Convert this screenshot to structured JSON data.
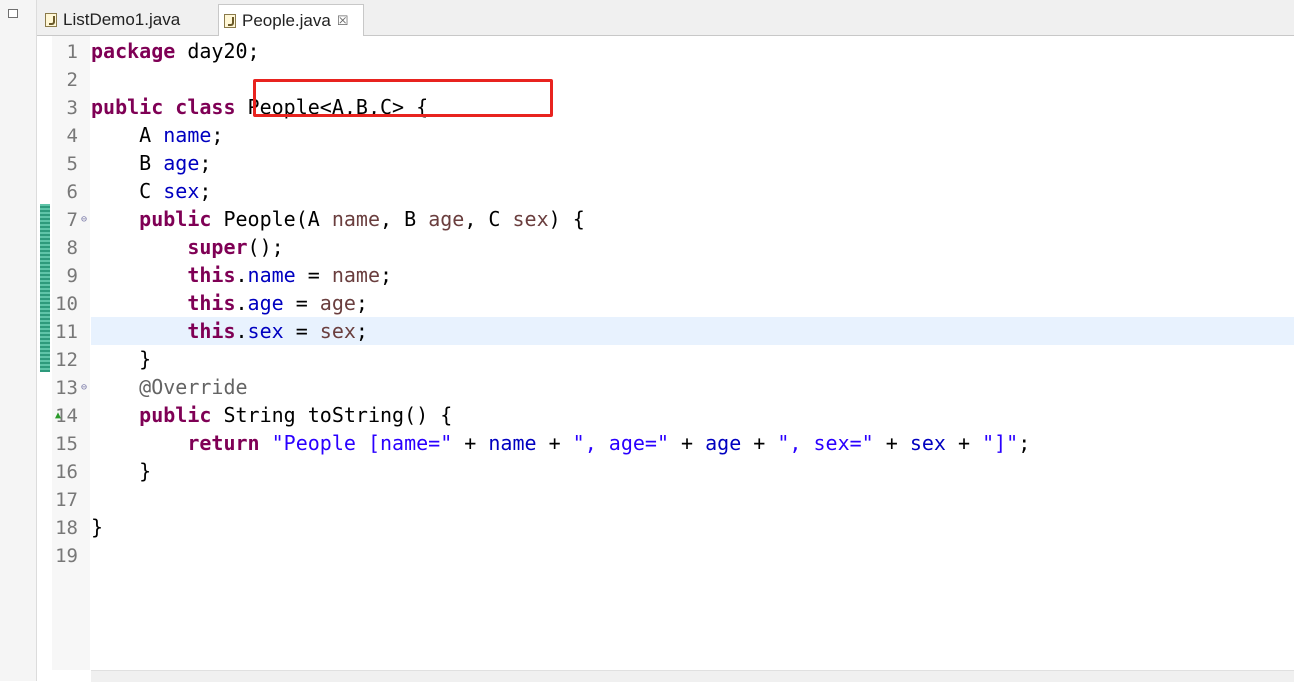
{
  "tabs": [
    {
      "label": "ListDemo1.java",
      "active": false
    },
    {
      "label": "People.java",
      "active": true,
      "close": "☒"
    }
  ],
  "colors": {
    "keyword": "#7f0055",
    "field": "#0000c0",
    "parameter": "#6a3e3e",
    "string": "#2a00ff",
    "annotation": "#646464",
    "current_line": "#e8f2fe",
    "highlight_box": "#e8231f",
    "change_bar": "#3aa88a"
  },
  "icons": {
    "tab_file": "java-file-icon",
    "fold": "fold-collapse-icon",
    "override": "override-marker-icon"
  },
  "editor": {
    "current_line": 11,
    "lines": [
      {
        "n": "1",
        "tokens": [
          {
            "t": "package",
            "c": "kw"
          },
          {
            "t": " day20;"
          }
        ]
      },
      {
        "n": "2",
        "tokens": []
      },
      {
        "n": "3",
        "tokens": [
          {
            "t": "public",
            "c": "kw"
          },
          {
            "t": " "
          },
          {
            "t": "class",
            "c": "kw"
          },
          {
            "t": " People<A,B,C> {"
          }
        ]
      },
      {
        "n": "4",
        "tokens": [
          {
            "t": "    A "
          },
          {
            "t": "name",
            "c": "fld"
          },
          {
            "t": ";"
          }
        ]
      },
      {
        "n": "5",
        "tokens": [
          {
            "t": "    B "
          },
          {
            "t": "age",
            "c": "fld"
          },
          {
            "t": ";"
          }
        ]
      },
      {
        "n": "6",
        "tokens": [
          {
            "t": "    C "
          },
          {
            "t": "sex",
            "c": "fld"
          },
          {
            "t": ";"
          }
        ]
      },
      {
        "n": "7",
        "fold": true,
        "tokens": [
          {
            "t": "    "
          },
          {
            "t": "public",
            "c": "kw"
          },
          {
            "t": " People(A "
          },
          {
            "t": "name",
            "c": "prm"
          },
          {
            "t": ", B "
          },
          {
            "t": "age",
            "c": "prm"
          },
          {
            "t": ", C "
          },
          {
            "t": "sex",
            "c": "prm"
          },
          {
            "t": ") {"
          }
        ]
      },
      {
        "n": "8",
        "tokens": [
          {
            "t": "        "
          },
          {
            "t": "super",
            "c": "kw"
          },
          {
            "t": "();"
          }
        ]
      },
      {
        "n": "9",
        "tokens": [
          {
            "t": "        "
          },
          {
            "t": "this",
            "c": "kw"
          },
          {
            "t": "."
          },
          {
            "t": "name",
            "c": "fld"
          },
          {
            "t": " = "
          },
          {
            "t": "name",
            "c": "prm"
          },
          {
            "t": ";"
          }
        ]
      },
      {
        "n": "10",
        "tokens": [
          {
            "t": "        "
          },
          {
            "t": "this",
            "c": "kw"
          },
          {
            "t": "."
          },
          {
            "t": "age",
            "c": "fld"
          },
          {
            "t": " = "
          },
          {
            "t": "age",
            "c": "prm"
          },
          {
            "t": ";"
          }
        ]
      },
      {
        "n": "11",
        "tokens": [
          {
            "t": "        "
          },
          {
            "t": "this",
            "c": "kw"
          },
          {
            "t": "."
          },
          {
            "t": "sex",
            "c": "fld"
          },
          {
            "t": " = "
          },
          {
            "t": "sex",
            "c": "prm"
          },
          {
            "t": ";"
          }
        ]
      },
      {
        "n": "12",
        "tokens": [
          {
            "t": "    }"
          }
        ]
      },
      {
        "n": "13",
        "fold": true,
        "tokens": [
          {
            "t": "    "
          },
          {
            "t": "@Override",
            "c": "ann"
          }
        ]
      },
      {
        "n": "14",
        "override": true,
        "tokens": [
          {
            "t": "    "
          },
          {
            "t": "public",
            "c": "kw"
          },
          {
            "t": " String toString() {"
          }
        ]
      },
      {
        "n": "15",
        "tokens": [
          {
            "t": "        "
          },
          {
            "t": "return",
            "c": "kw"
          },
          {
            "t": " "
          },
          {
            "t": "\"People [name=\"",
            "c": "str"
          },
          {
            "t": " + "
          },
          {
            "t": "name",
            "c": "fld"
          },
          {
            "t": " + "
          },
          {
            "t": "\", age=\"",
            "c": "str"
          },
          {
            "t": " + "
          },
          {
            "t": "age",
            "c": "fld"
          },
          {
            "t": " + "
          },
          {
            "t": "\", sex=\"",
            "c": "str"
          },
          {
            "t": " + "
          },
          {
            "t": "sex",
            "c": "fld"
          },
          {
            "t": " + "
          },
          {
            "t": "\"]\"",
            "c": "str"
          },
          {
            "t": ";"
          }
        ]
      },
      {
        "n": "16",
        "tokens": [
          {
            "t": "    }"
          }
        ]
      },
      {
        "n": "17",
        "tokens": []
      },
      {
        "n": "18",
        "tokens": [
          {
            "t": "}"
          }
        ]
      },
      {
        "n": "19",
        "tokens": []
      }
    ]
  }
}
